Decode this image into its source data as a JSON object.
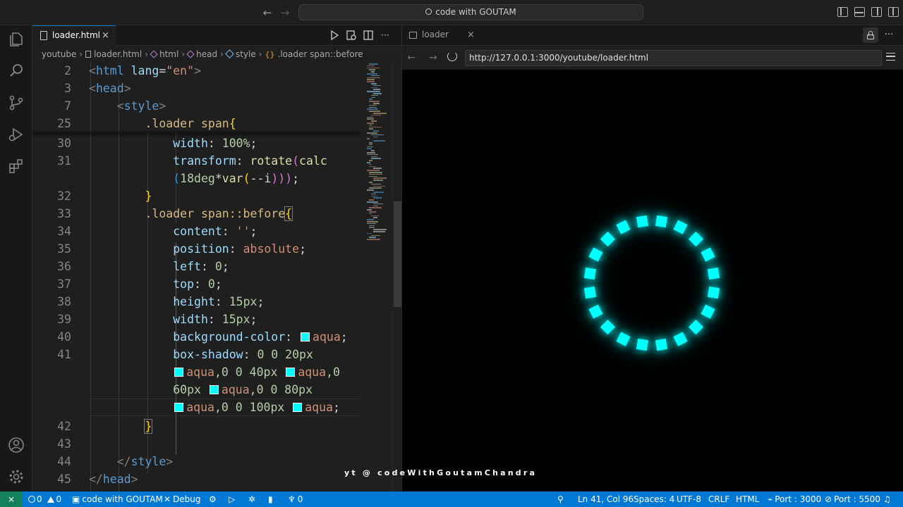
{
  "titlebar": {
    "search_text": "code with GOUTAM"
  },
  "editor": {
    "tab_label": "loader.html",
    "tab_close": "×",
    "breadcrumb": [
      "youtube",
      "loader.html",
      "html",
      "head",
      "style",
      ".loader span::before"
    ]
  },
  "browser": {
    "tab_label": "loader",
    "tab_close": "×",
    "url": "http://127.0.0.1:3000/youtube/loader.html",
    "accent_color": "#00ffff",
    "dot_count": 20
  },
  "watermark": "yt @ codeWithGoutamChandra",
  "statusbar": {
    "errors": "0",
    "warnings": "0",
    "branch": "code with GOUTAM",
    "debug": "Debug",
    "ports": "0",
    "position": "Ln 41, Col 96",
    "spaces": "Spaces: 4",
    "encoding": "UTF-8",
    "eol": "CRLF",
    "language": "HTML",
    "port1": "Port : 3000",
    "port2": "Port : 5500"
  },
  "code": {
    "numbers": {
      "l2": "2",
      "l3": "3",
      "l7": "7",
      "l25": "25",
      "l30": "30",
      "l31": "31",
      "l32": "32",
      "l33": "33",
      "l34": "34",
      "l35": "35",
      "l36": "36",
      "l37": "37",
      "l38": "38",
      "l39": "39",
      "l40": "40",
      "l41": "41",
      "l42": "42",
      "l43": "43",
      "l44": "44",
      "l45": "45"
    },
    "l2_open": "<",
    "l2_tag": "html",
    "l2_attr": "lang",
    "l2_eq": "=",
    "l2_val": "\"en\"",
    "l2_close": ">",
    "l3_open": "<",
    "l3_tag": "head",
    "l3_close": ">",
    "l7_open": "<",
    "l7_tag": "style",
    "l7_close": ">",
    "l25_sel": ".loader span",
    "l25_brace": "{",
    "l30_prop": "width",
    "l30_colon": ": ",
    "l30_val": "100%",
    "l30_end": ";",
    "l31_prop": "transform",
    "l31_colon": ": ",
    "l31_fn": "rotate",
    "l31_p": "(",
    "l31_fn2": "calc",
    "l31b_p": "(",
    "l31b_num": "18deg",
    "l31b_star": "*",
    "l31b_fn": "var",
    "l31b_p2": "(",
    "l31b_var": "--i",
    "l31b_cl": ")))",
    "l31b_end": ";",
    "l32_brace": "}",
    "l33_sel": ".loader span::before",
    "l33_brace": "{",
    "l34_prop": "content",
    "l34_colon": ": ",
    "l34_val": "''",
    "l34_end": ";",
    "l35_prop": "position",
    "l35_colon": ": ",
    "l35_val": "absolute",
    "l35_end": ";",
    "l36_prop": "left",
    "l36_colon": ": ",
    "l36_val": "0",
    "l36_end": ";",
    "l37_prop": "top",
    "l37_colon": ": ",
    "l37_val": "0",
    "l37_end": ";",
    "l38_prop": "height",
    "l38_colon": ": ",
    "l38_val": "15px",
    "l38_end": ";",
    "l39_prop": "width",
    "l39_colon": ": ",
    "l39_val": "15px",
    "l39_end": ";",
    "l40_prop": "background-color",
    "l40_colon": ": ",
    "l40_val": "aqua",
    "l40_end": ";",
    "l41_prop": "box-shadow",
    "l41_colon": ": ",
    "l41_val": "0 0 20px",
    "l41b_a": "aqua",
    "l41b_b": ",0 0 40px ",
    "l41b_c": "aqua",
    "l41b_d": ",0",
    "l41c_a": "60px ",
    "l41c_b": "aqua",
    "l41c_c": ",0 0 80px",
    "l41d_a": "aqua",
    "l41d_b": ",0 0 100px ",
    "l41d_c": "aqua",
    "l41d_d": ";",
    "l42_brace": "}",
    "l44_open": "</",
    "l44_tag": "style",
    "l44_close": ">",
    "l45_open": "</",
    "l45_tag": "head",
    "l45_close": ">"
  }
}
